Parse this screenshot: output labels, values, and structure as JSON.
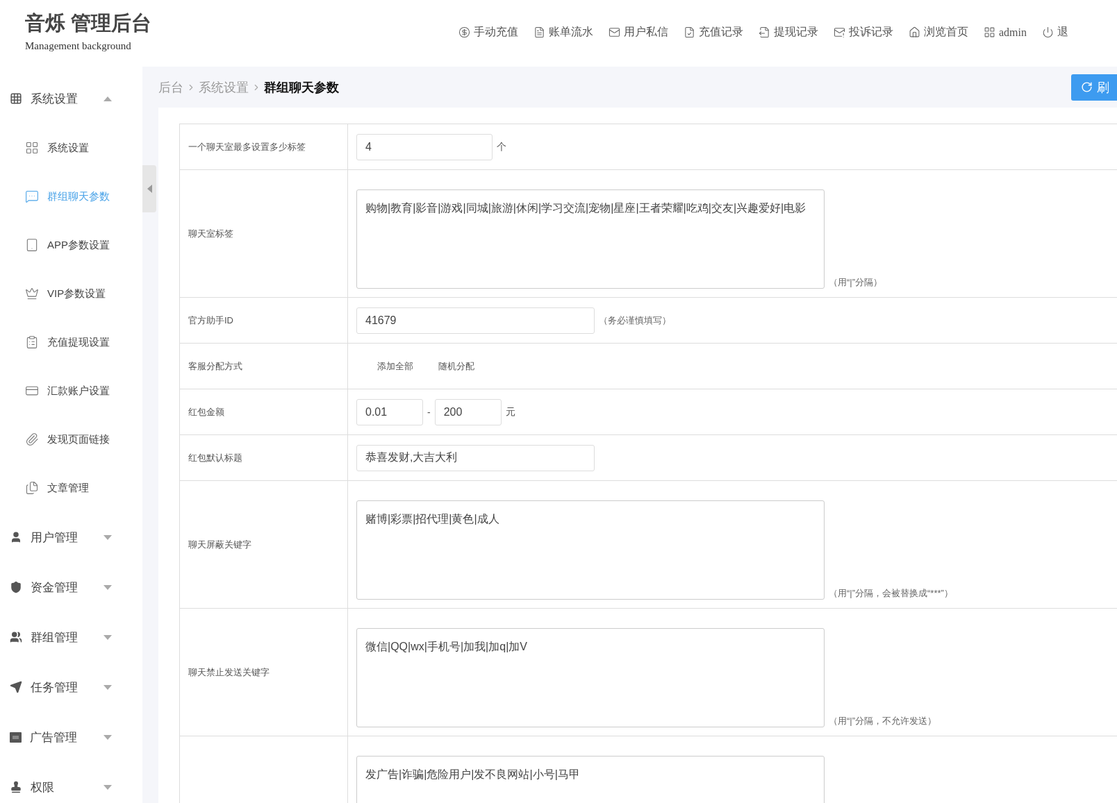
{
  "header": {
    "logo_title": "音烁 管理后台",
    "logo_subtitle": "Management background",
    "nav": [
      {
        "label": "手动充值"
      },
      {
        "label": "账单流水"
      },
      {
        "label": "用户私信"
      },
      {
        "label": "充值记录"
      },
      {
        "label": "提现记录"
      },
      {
        "label": "投诉记录"
      },
      {
        "label": "浏览首页"
      },
      {
        "label": "admin"
      },
      {
        "label": "退"
      }
    ]
  },
  "sidebar": {
    "groups": [
      {
        "label": "系统设置",
        "expanded": true,
        "children": [
          {
            "label": "系统设置",
            "selected": false
          },
          {
            "label": "群组聊天参数",
            "selected": true
          },
          {
            "label": "APP参数设置",
            "selected": false
          },
          {
            "label": "VIP参数设置",
            "selected": false
          },
          {
            "label": "充值提现设置",
            "selected": false
          },
          {
            "label": "汇款账户设置",
            "selected": false
          },
          {
            "label": "发现页面链接",
            "selected": false
          },
          {
            "label": "文章管理",
            "selected": false
          }
        ]
      },
      {
        "label": "用户管理",
        "expanded": false
      },
      {
        "label": "资金管理",
        "expanded": false
      },
      {
        "label": "群组管理",
        "expanded": false
      },
      {
        "label": "任务管理",
        "expanded": false
      },
      {
        "label": "广告管理",
        "expanded": false
      },
      {
        "label": "权限",
        "expanded": false
      }
    ]
  },
  "breadcrumb": [
    "后台",
    "系统设置",
    "群组聊天参数"
  ],
  "refresh_button": "刷",
  "form": {
    "rows": [
      {
        "kind": "input",
        "label": "一个聊天室最多设置多少标签",
        "value": "4",
        "suffix": "个"
      },
      {
        "kind": "textarea",
        "label": "聊天室标签",
        "value": "购物|教育|影音|游戏|同城|旅游|休闲|学习交流|宠物|星座|王者荣耀|吃鸡|交友|兴趣爱好|电影",
        "note": "（用“|”分隔）"
      },
      {
        "kind": "wide_input",
        "label": "官方助手ID",
        "value": "41679",
        "note": "（务必谨慎填写）"
      },
      {
        "kind": "options",
        "label": "客服分配方式",
        "options": [
          "添加全部",
          "随机分配"
        ]
      },
      {
        "kind": "range",
        "label": "红包金额",
        "values": [
          "0.01",
          "200"
        ],
        "separator": "-",
        "suffix": "元"
      },
      {
        "kind": "wide_input",
        "label": "红包默认标题",
        "value": "恭喜发财,大吉大利"
      },
      {
        "kind": "textarea",
        "label": "聊天屏蔽关键字",
        "value": "赌博|彩票|招代理|黄色|成人",
        "note": "（用“|”分隔，会被替换成“***”）"
      },
      {
        "kind": "textarea",
        "label": "聊天禁止发送关键字",
        "value": "微信|QQ|wx|手机号|加我|加q|加V",
        "note": "（用“|”分隔，不允许发送）"
      },
      {
        "kind": "textarea",
        "value": "发广告|诈骗|危险用户|发不良网站|小号|马甲"
      }
    ]
  }
}
